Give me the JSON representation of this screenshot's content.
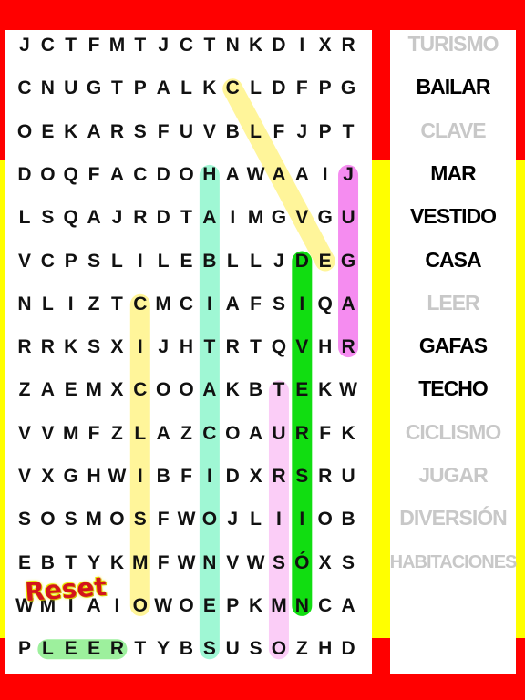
{
  "grid": [
    "JCTFMTJCTNKDIXR",
    "CNUGTPALKCLDFPG",
    "OEKARSFUVBLFJPT",
    "DOQFACDOHAWAAIJ",
    "LSQAJRDTAIMGVGU",
    "VCPSLILEBLLJDEG",
    "NLIZTCMCIAFSIQA",
    "RRKSXIJHTRTQVHR",
    "ZAEMXCOOAKBTEKW",
    "VVMFZLAZCOAURFK",
    "VXGHWIBFIDXRSRU",
    "SOSMOSFWOJLIIOB",
    "EBTYKMFWNVWSÓXS",
    "WMIAIOWOEPKMNCA",
    "PLEERTYBSUSOZHD"
  ],
  "found_highlights": [
    {
      "word": "CLAVE",
      "start": [
        1,
        9
      ],
      "end": [
        5,
        13
      ],
      "color": "#fff59a"
    },
    {
      "word": "HABITACIONES",
      "start": [
        3,
        8
      ],
      "end": [
        14,
        8
      ],
      "color": "#9ff7d4"
    },
    {
      "word": "JUGAR",
      "start": [
        3,
        14
      ],
      "end": [
        7,
        14
      ],
      "color": "#f58cf0"
    },
    {
      "word": "DIVERSIÓN",
      "start": [
        5,
        12
      ],
      "end": [
        13,
        12
      ],
      "color": "#11dd11"
    },
    {
      "word": "CICLISMO",
      "start": [
        6,
        5
      ],
      "end": [
        13,
        5
      ],
      "color": "#fff59a"
    },
    {
      "word": "TURISMO",
      "start": [
        8,
        11
      ],
      "end": [
        14,
        11
      ],
      "color": "#fbcdf7"
    },
    {
      "word": "LEER",
      "start": [
        14,
        1
      ],
      "end": [
        14,
        4
      ],
      "color": "#9df09d"
    }
  ],
  "words": [
    {
      "text": "TURISMO",
      "found": true
    },
    {
      "text": "BAILAR",
      "found": false
    },
    {
      "text": "CLAVE",
      "found": true
    },
    {
      "text": "MAR",
      "found": false
    },
    {
      "text": "VESTIDO",
      "found": false
    },
    {
      "text": "CASA",
      "found": false
    },
    {
      "text": "LEER",
      "found": true
    },
    {
      "text": "GAFAS",
      "found": false
    },
    {
      "text": "TECHO",
      "found": false
    },
    {
      "text": "CICLISMO",
      "found": true
    },
    {
      "text": "JUGAR",
      "found": true
    },
    {
      "text": "DIVERSIÓN",
      "found": true
    },
    {
      "text": "HABITACIONES",
      "found": true
    }
  ],
  "reset_label": "Reset",
  "colors": {
    "flag_red": "#ff0000",
    "flag_yellow": "#ffff00",
    "found_word": "#c8c8c8"
  }
}
